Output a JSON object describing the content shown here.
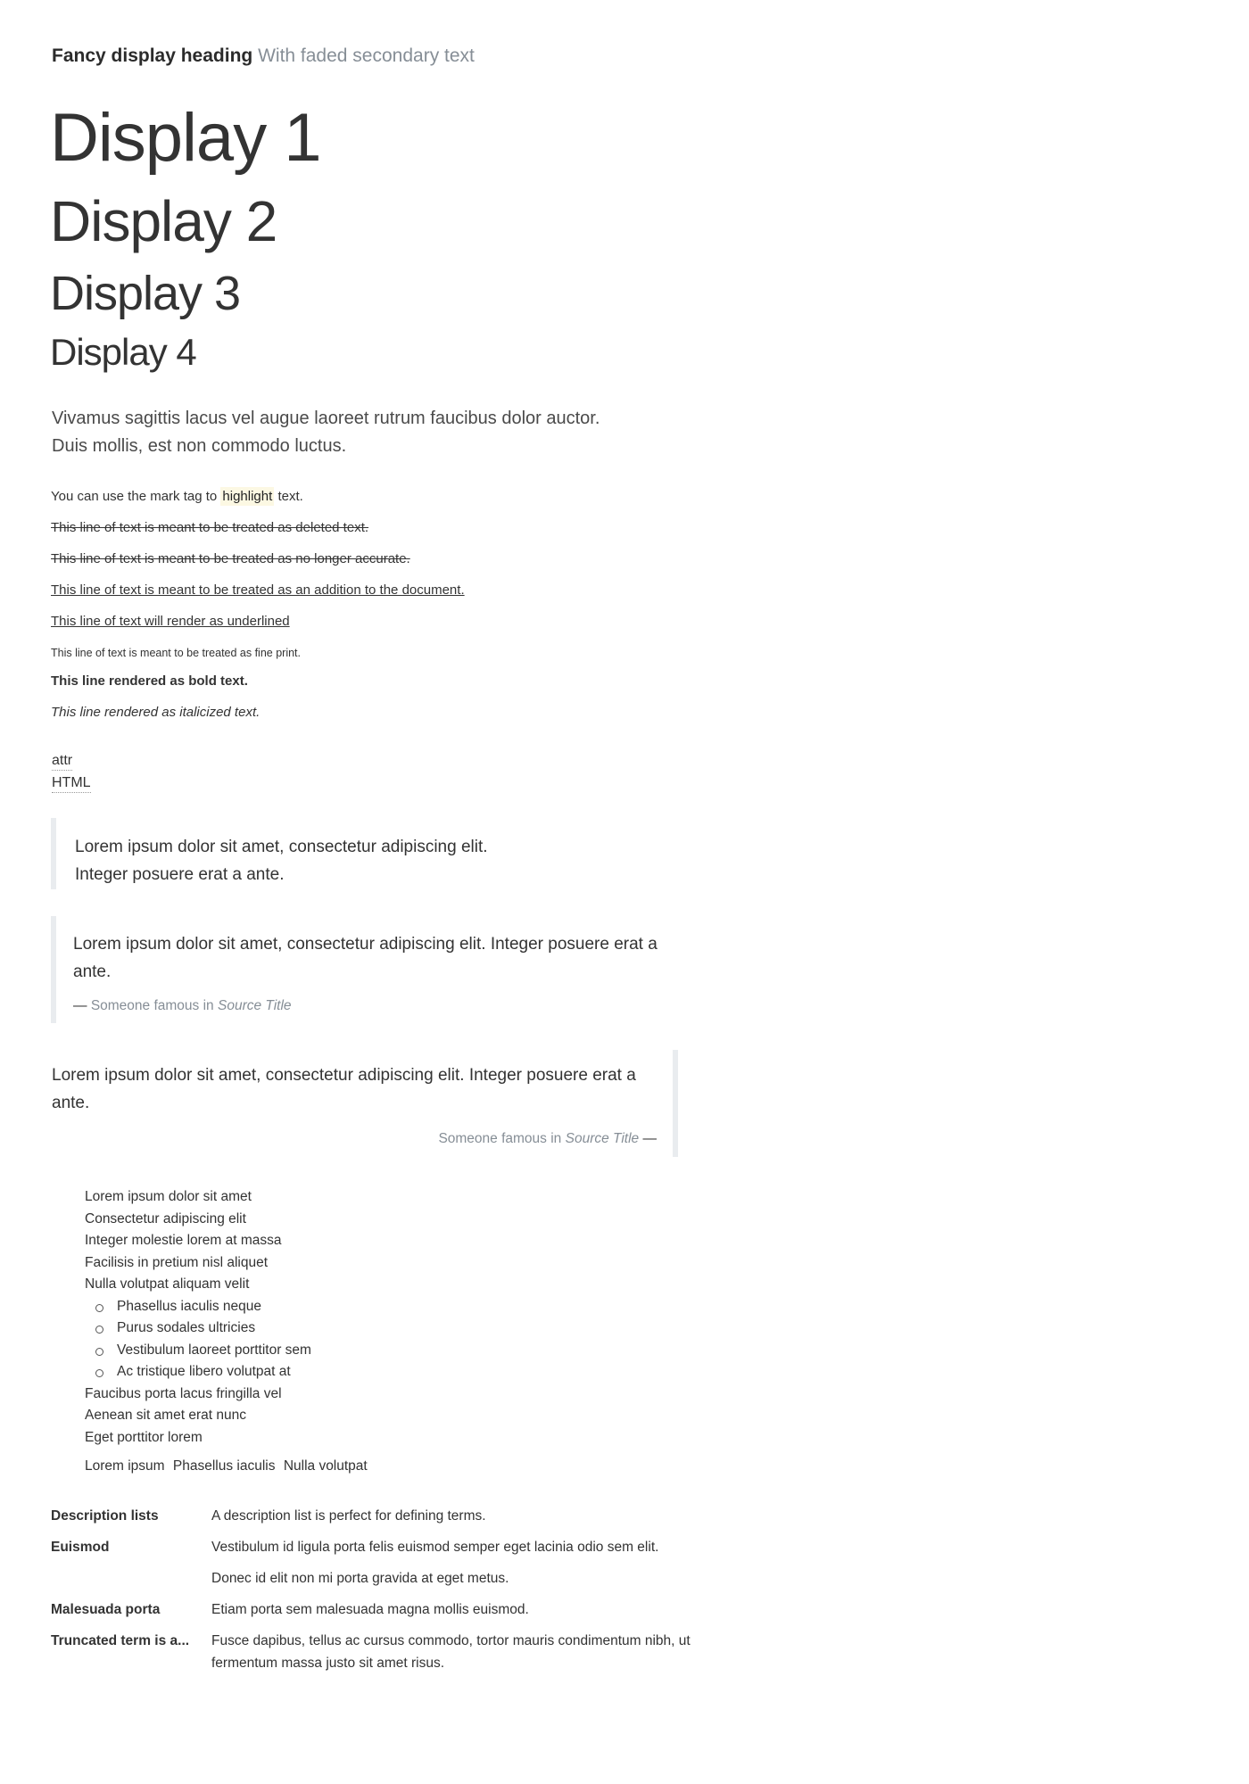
{
  "fancy_heading": {
    "main": "Fancy display heading",
    "secondary": "With faded secondary text"
  },
  "displays": [
    "Display 1",
    "Display 2",
    "Display 3",
    "Display 4"
  ],
  "lead": {
    "line1": "Vivamus sagittis lacus vel augue laoreet rutrum faucibus dolor auctor.",
    "line2": "Duis mollis, est non commodo luctus."
  },
  "inline_text": {
    "mark_before": "You can use the mark tag to ",
    "mark_word": "highlight",
    "mark_after": " text.",
    "deleted": "This line of text is meant to be treated as deleted text.",
    "strikethrough": "This line of text is meant to be treated as no longer accurate.",
    "inserted": "This line of text is meant to be treated as an addition to the document.",
    "underlined": "This line of text will render as underlined",
    "small": "This line of text is meant to be treated as fine print.",
    "bold": "This line rendered as bold text.",
    "italic": "This line rendered as italicized text."
  },
  "abbreviations": [
    "attr",
    "HTML"
  ],
  "blockquotes": {
    "simple": {
      "line1": "Lorem ipsum dolor sit amet, consectetur adipiscing elit.",
      "line2": "Integer posuere erat a ante."
    },
    "with_footer": {
      "text": "Lorem ipsum dolor sit amet, consectetur adipiscing elit. Integer posuere erat a ante.",
      "dash": "—",
      "source_prefix": "Someone famous in ",
      "source_title": "Source Title"
    },
    "right_aligned": {
      "text": "Lorem ipsum dolor sit amet, consectetur adipiscing elit. Integer posuere erat a ante.",
      "dash": "—",
      "source_prefix": "Someone famous in ",
      "source_title": "Source Title"
    }
  },
  "unstyled_list": {
    "items_before": [
      "Lorem ipsum dolor sit amet",
      "Consectetur adipiscing elit",
      "Integer molestie lorem at massa",
      "Facilisis in pretium nisl aliquet",
      "Nulla volutpat aliquam velit"
    ],
    "nested": [
      "Phasellus iaculis neque",
      "Purus sodales ultricies",
      "Vestibulum laoreet porttitor sem",
      "Ac tristique libero volutpat at"
    ],
    "items_after": [
      "Faucibus porta lacus fringilla vel",
      "Aenean sit amet erat nunc",
      "Eget porttitor lorem"
    ]
  },
  "inline_list": [
    "Lorem ipsum",
    "Phasellus iaculis",
    "Nulla volutpat"
  ],
  "description_list": [
    {
      "term": "Description lists",
      "desc": "A description list is perfect for defining terms."
    },
    {
      "term": "Euismod",
      "desc": "Vestibulum id ligula porta felis euismod semper eget lacinia odio sem  elit."
    },
    {
      "term": "",
      "desc": "Donec id elit non mi porta gravida at eget metus."
    },
    {
      "term": "Malesuada porta",
      "desc": "Etiam porta sem malesuada magna mollis euismod."
    },
    {
      "term": "Truncated term is a...",
      "desc": "Fusce dapibus, tellus ac cursus commodo, tortor mauris condimentum nibh, ut fermentum massa justo sit amet risus."
    }
  ],
  "colors": {
    "text": "#333333",
    "muted": "#868e96",
    "mark_bg": "#fcf8e3",
    "blockquote_border": "#e9ecef"
  }
}
